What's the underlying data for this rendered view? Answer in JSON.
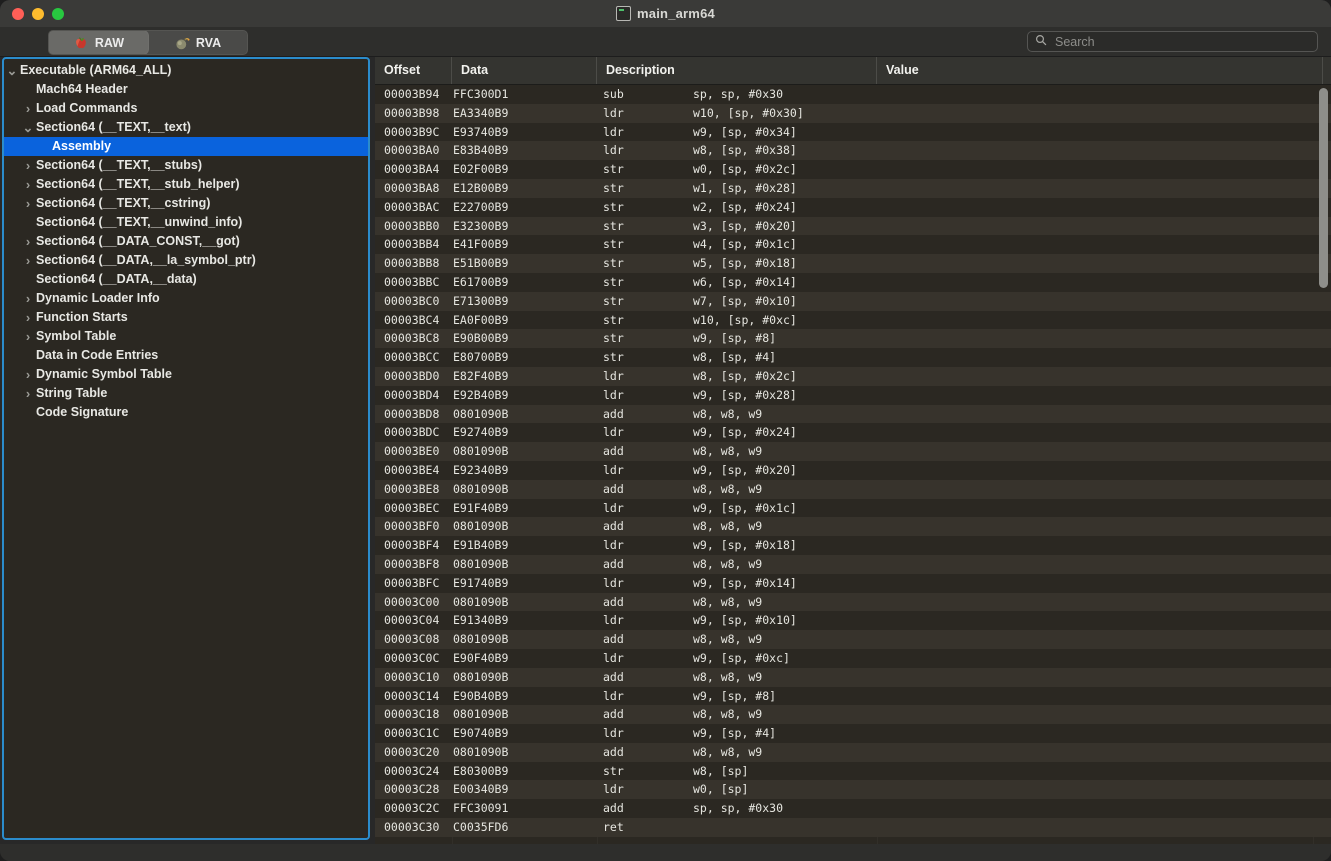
{
  "window": {
    "title": "main_arm64",
    "doc_icon": "terminal-document-icon",
    "traffic_lights": [
      "close",
      "minimize",
      "zoom"
    ]
  },
  "toolbar": {
    "tabs": [
      {
        "id": "raw",
        "label": "RAW",
        "icon": "apple-icon",
        "selected": true
      },
      {
        "id": "rva",
        "label": "RVA",
        "icon": "bomb-icon",
        "selected": false
      }
    ],
    "search": {
      "icon": "search-icon",
      "placeholder": "Search",
      "value": ""
    }
  },
  "sidebar": {
    "items": [
      {
        "label": "Executable  (ARM64_ALL)",
        "indent": 0,
        "twisty": "expanded",
        "selected": false
      },
      {
        "label": "Mach64 Header",
        "indent": 1,
        "twisty": "none",
        "selected": false
      },
      {
        "label": "Load Commands",
        "indent": 1,
        "twisty": "collapsed",
        "selected": false
      },
      {
        "label": "Section64 (__TEXT,__text)",
        "indent": 1,
        "twisty": "expanded",
        "selected": false
      },
      {
        "label": "Assembly",
        "indent": 2,
        "twisty": "none",
        "selected": true
      },
      {
        "label": "Section64 (__TEXT,__stubs)",
        "indent": 1,
        "twisty": "collapsed",
        "selected": false
      },
      {
        "label": "Section64 (__TEXT,__stub_helper)",
        "indent": 1,
        "twisty": "collapsed",
        "selected": false
      },
      {
        "label": "Section64 (__TEXT,__cstring)",
        "indent": 1,
        "twisty": "collapsed",
        "selected": false
      },
      {
        "label": "Section64 (__TEXT,__unwind_info)",
        "indent": 1,
        "twisty": "none",
        "selected": false
      },
      {
        "label": "Section64 (__DATA_CONST,__got)",
        "indent": 1,
        "twisty": "collapsed",
        "selected": false
      },
      {
        "label": "Section64 (__DATA,__la_symbol_ptr)",
        "indent": 1,
        "twisty": "collapsed",
        "selected": false
      },
      {
        "label": "Section64 (__DATA,__data)",
        "indent": 1,
        "twisty": "none",
        "selected": false
      },
      {
        "label": "Dynamic Loader Info",
        "indent": 1,
        "twisty": "collapsed",
        "selected": false
      },
      {
        "label": "Function Starts",
        "indent": 1,
        "twisty": "collapsed",
        "selected": false
      },
      {
        "label": "Symbol Table",
        "indent": 1,
        "twisty": "collapsed",
        "selected": false
      },
      {
        "label": "Data in Code Entries",
        "indent": 1,
        "twisty": "none",
        "selected": false
      },
      {
        "label": "Dynamic Symbol Table",
        "indent": 1,
        "twisty": "collapsed",
        "selected": false
      },
      {
        "label": "String Table",
        "indent": 1,
        "twisty": "collapsed",
        "selected": false
      },
      {
        "label": "Code Signature",
        "indent": 1,
        "twisty": "none",
        "selected": false
      }
    ]
  },
  "table": {
    "columns": [
      {
        "key": "offset",
        "label": "Offset"
      },
      {
        "key": "data",
        "label": "Data"
      },
      {
        "key": "description",
        "label": "Description"
      },
      {
        "key": "value",
        "label": "Value"
      }
    ],
    "rows": [
      {
        "offset": "00003B94",
        "data": "FFC300D1",
        "mnemonic": "sub",
        "operands": "sp, sp, #0x30",
        "value": ""
      },
      {
        "offset": "00003B98",
        "data": "EA3340B9",
        "mnemonic": "ldr",
        "operands": "w10, [sp, #0x30]",
        "value": ""
      },
      {
        "offset": "00003B9C",
        "data": "E93740B9",
        "mnemonic": "ldr",
        "operands": "w9, [sp, #0x34]",
        "value": ""
      },
      {
        "offset": "00003BA0",
        "data": "E83B40B9",
        "mnemonic": "ldr",
        "operands": "w8, [sp, #0x38]",
        "value": ""
      },
      {
        "offset": "00003BA4",
        "data": "E02F00B9",
        "mnemonic": "str",
        "operands": "w0, [sp, #0x2c]",
        "value": ""
      },
      {
        "offset": "00003BA8",
        "data": "E12B00B9",
        "mnemonic": "str",
        "operands": "w1, [sp, #0x28]",
        "value": ""
      },
      {
        "offset": "00003BAC",
        "data": "E22700B9",
        "mnemonic": "str",
        "operands": "w2, [sp, #0x24]",
        "value": ""
      },
      {
        "offset": "00003BB0",
        "data": "E32300B9",
        "mnemonic": "str",
        "operands": "w3, [sp, #0x20]",
        "value": ""
      },
      {
        "offset": "00003BB4",
        "data": "E41F00B9",
        "mnemonic": "str",
        "operands": "w4, [sp, #0x1c]",
        "value": ""
      },
      {
        "offset": "00003BB8",
        "data": "E51B00B9",
        "mnemonic": "str",
        "operands": "w5, [sp, #0x18]",
        "value": ""
      },
      {
        "offset": "00003BBC",
        "data": "E61700B9",
        "mnemonic": "str",
        "operands": "w6, [sp, #0x14]",
        "value": ""
      },
      {
        "offset": "00003BC0",
        "data": "E71300B9",
        "mnemonic": "str",
        "operands": "w7, [sp, #0x10]",
        "value": ""
      },
      {
        "offset": "00003BC4",
        "data": "EA0F00B9",
        "mnemonic": "str",
        "operands": "w10, [sp, #0xc]",
        "value": ""
      },
      {
        "offset": "00003BC8",
        "data": "E90B00B9",
        "mnemonic": "str",
        "operands": "w9, [sp, #8]",
        "value": ""
      },
      {
        "offset": "00003BCC",
        "data": "E80700B9",
        "mnemonic": "str",
        "operands": "w8, [sp, #4]",
        "value": ""
      },
      {
        "offset": "00003BD0",
        "data": "E82F40B9",
        "mnemonic": "ldr",
        "operands": "w8, [sp, #0x2c]",
        "value": ""
      },
      {
        "offset": "00003BD4",
        "data": "E92B40B9",
        "mnemonic": "ldr",
        "operands": "w9, [sp, #0x28]",
        "value": ""
      },
      {
        "offset": "00003BD8",
        "data": "0801090B",
        "mnemonic": "add",
        "operands": "w8, w8, w9",
        "value": ""
      },
      {
        "offset": "00003BDC",
        "data": "E92740B9",
        "mnemonic": "ldr",
        "operands": "w9, [sp, #0x24]",
        "value": ""
      },
      {
        "offset": "00003BE0",
        "data": "0801090B",
        "mnemonic": "add",
        "operands": "w8, w8, w9",
        "value": ""
      },
      {
        "offset": "00003BE4",
        "data": "E92340B9",
        "mnemonic": "ldr",
        "operands": "w9, [sp, #0x20]",
        "value": ""
      },
      {
        "offset": "00003BE8",
        "data": "0801090B",
        "mnemonic": "add",
        "operands": "w8, w8, w9",
        "value": ""
      },
      {
        "offset": "00003BEC",
        "data": "E91F40B9",
        "mnemonic": "ldr",
        "operands": "w9, [sp, #0x1c]",
        "value": ""
      },
      {
        "offset": "00003BF0",
        "data": "0801090B",
        "mnemonic": "add",
        "operands": "w8, w8, w9",
        "value": ""
      },
      {
        "offset": "00003BF4",
        "data": "E91B40B9",
        "mnemonic": "ldr",
        "operands": "w9, [sp, #0x18]",
        "value": ""
      },
      {
        "offset": "00003BF8",
        "data": "0801090B",
        "mnemonic": "add",
        "operands": "w8, w8, w9",
        "value": ""
      },
      {
        "offset": "00003BFC",
        "data": "E91740B9",
        "mnemonic": "ldr",
        "operands": "w9, [sp, #0x14]",
        "value": ""
      },
      {
        "offset": "00003C00",
        "data": "0801090B",
        "mnemonic": "add",
        "operands": "w8, w8, w9",
        "value": ""
      },
      {
        "offset": "00003C04",
        "data": "E91340B9",
        "mnemonic": "ldr",
        "operands": "w9, [sp, #0x10]",
        "value": ""
      },
      {
        "offset": "00003C08",
        "data": "0801090B",
        "mnemonic": "add",
        "operands": "w8, w8, w9",
        "value": ""
      },
      {
        "offset": "00003C0C",
        "data": "E90F40B9",
        "mnemonic": "ldr",
        "operands": "w9, [sp, #0xc]",
        "value": ""
      },
      {
        "offset": "00003C10",
        "data": "0801090B",
        "mnemonic": "add",
        "operands": "w8, w8, w9",
        "value": ""
      },
      {
        "offset": "00003C14",
        "data": "E90B40B9",
        "mnemonic": "ldr",
        "operands": "w9, [sp, #8]",
        "value": ""
      },
      {
        "offset": "00003C18",
        "data": "0801090B",
        "mnemonic": "add",
        "operands": "w8, w8, w9",
        "value": ""
      },
      {
        "offset": "00003C1C",
        "data": "E90740B9",
        "mnemonic": "ldr",
        "operands": "w9, [sp, #4]",
        "value": ""
      },
      {
        "offset": "00003C20",
        "data": "0801090B",
        "mnemonic": "add",
        "operands": "w8, w8, w9",
        "value": ""
      },
      {
        "offset": "00003C24",
        "data": "E80300B9",
        "mnemonic": "str",
        "operands": "w8, [sp]",
        "value": ""
      },
      {
        "offset": "00003C28",
        "data": "E00340B9",
        "mnemonic": "ldr",
        "operands": "w0, [sp]",
        "value": ""
      },
      {
        "offset": "00003C2C",
        "data": "FFC30091",
        "mnemonic": "add",
        "operands": "sp, sp, #0x30",
        "value": ""
      },
      {
        "offset": "00003C30",
        "data": "C0035FD6",
        "mnemonic": "ret",
        "operands": "",
        "value": ""
      }
    ]
  },
  "colors": {
    "accent_selection": "#0a63dd",
    "focus_ring": "#2b8ccc",
    "row_odd": "#2b2822",
    "row_even": "#37332c",
    "header_bg": "#343430",
    "titlebar_bg": "#3a3a38"
  }
}
